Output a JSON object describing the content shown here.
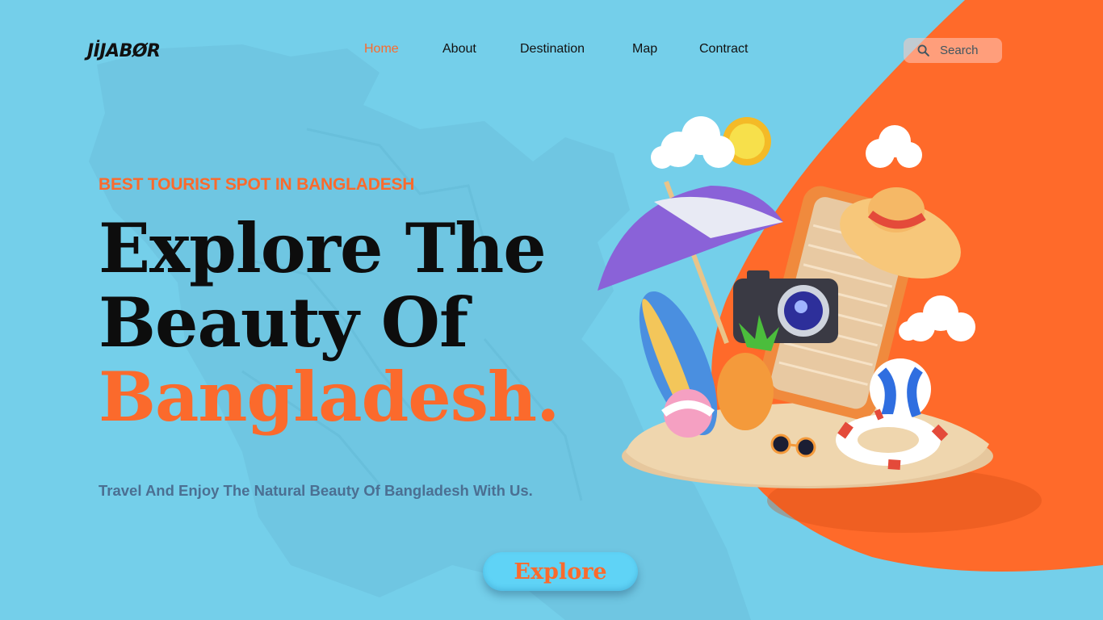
{
  "brand": {
    "logo_text": "JİJABØR"
  },
  "nav": {
    "items": [
      {
        "label": "Home",
        "active": true
      },
      {
        "label": "About"
      },
      {
        "label": "Destination"
      },
      {
        "label": "Map"
      },
      {
        "label": "Contract"
      }
    ],
    "search_placeholder": "Search"
  },
  "hero": {
    "eyebrow": "BEST TOURIST SPOT IN BANGLADESH",
    "headline_line1": "Explore The",
    "headline_line2": "Beauty Of",
    "headline_accent": "Bangladesh.",
    "subtitle": "Travel And Enjoy The Natural Beauty Of Bangladesh With Us.",
    "cta_label": "Explore"
  },
  "colors": {
    "background": "#74cfea",
    "accent": "#fb6a2c",
    "headline": "#0d0d0d",
    "subtitle": "#4b6f92",
    "button": "#5fd3f6"
  },
  "icons": {
    "search": "search-icon"
  }
}
